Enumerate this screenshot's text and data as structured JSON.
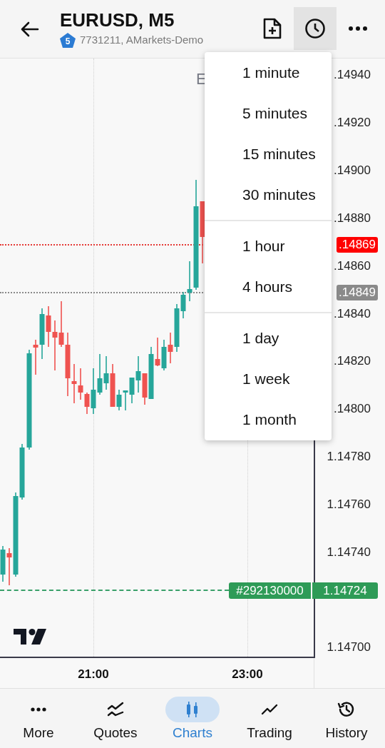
{
  "header": {
    "title": "EURUSD, M5",
    "account_badge": "5",
    "account": "7731211, AMarkets-Demo",
    "actions": [
      {
        "kind": "new-file",
        "active": false
      },
      {
        "kind": "clock",
        "active": true
      },
      {
        "kind": "more",
        "active": false
      }
    ]
  },
  "chart": {
    "legend": "E",
    "price_ticks": [
      ".14940",
      ".14920",
      ".14900",
      ".14880",
      ".14860",
      ".14840",
      ".14820",
      ".14800",
      "1.14780",
      "1.14760",
      "1.14740",
      "1.14700"
    ],
    "time_ticks": [
      "21:00",
      "23:00"
    ],
    "ask_price": ".14869",
    "bid_price": ".14849",
    "order": {
      "ticket": "#292130000",
      "price": "1.14724"
    }
  },
  "time_menu": {
    "groups": [
      {
        "items": [
          "1 minute",
          "5 minutes",
          "15 minutes",
          "30 minutes"
        ]
      },
      {
        "items": [
          "1 hour",
          "4 hours"
        ]
      },
      {
        "items": [
          "1 day",
          "1 week",
          "1 month"
        ]
      }
    ]
  },
  "nav": [
    {
      "kind": "more",
      "label": "More",
      "selected": false
    },
    {
      "kind": "quotes",
      "label": "Quotes",
      "selected": false
    },
    {
      "kind": "charts",
      "label": "Charts",
      "selected": true
    },
    {
      "kind": "trading",
      "label": "Trading",
      "selected": false
    },
    {
      "kind": "history",
      "label": "History",
      "selected": false
    }
  ]
}
